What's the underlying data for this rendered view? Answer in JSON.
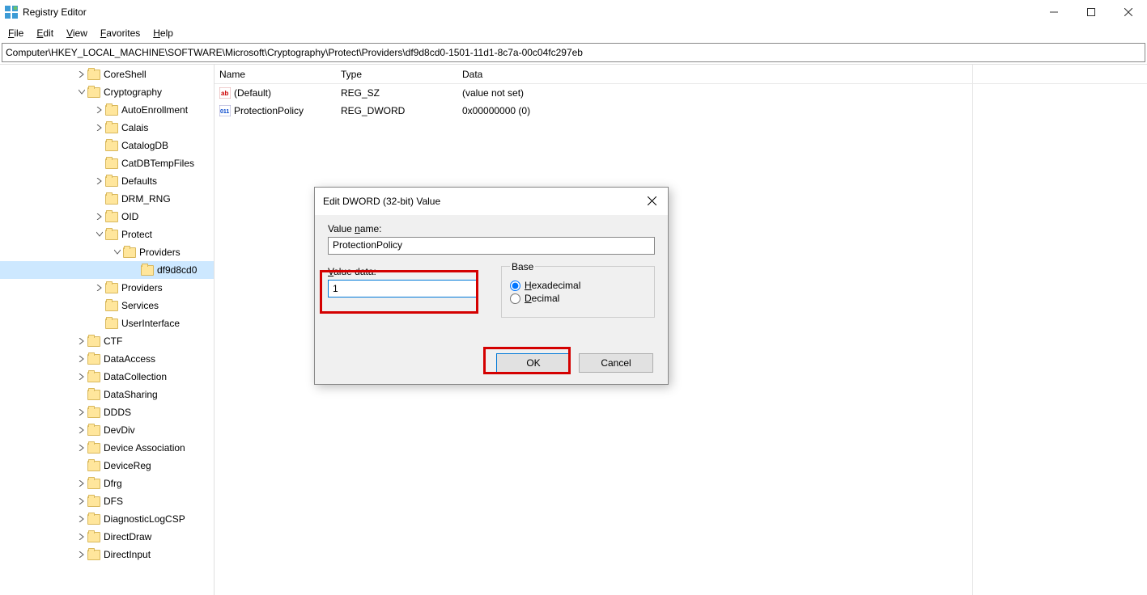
{
  "titlebar": {
    "title": "Registry Editor"
  },
  "menu": {
    "file": "File",
    "edit": "Edit",
    "view": "View",
    "favorites": "Favorites",
    "help": "Help"
  },
  "path": "Computer\\HKEY_LOCAL_MACHINE\\SOFTWARE\\Microsoft\\Cryptography\\Protect\\Providers\\df9d8cd0-1501-11d1-8c7a-00c04fc297eb",
  "tree": [
    {
      "indent": 94,
      "chev": ">",
      "label": "CoreShell"
    },
    {
      "indent": 94,
      "chev": "v",
      "label": "Cryptography"
    },
    {
      "indent": 116,
      "chev": ">",
      "label": "AutoEnrollment"
    },
    {
      "indent": 116,
      "chev": ">",
      "label": "Calais"
    },
    {
      "indent": 116,
      "chev": "",
      "label": "CatalogDB"
    },
    {
      "indent": 116,
      "chev": "",
      "label": "CatDBTempFiles"
    },
    {
      "indent": 116,
      "chev": ">",
      "label": "Defaults"
    },
    {
      "indent": 116,
      "chev": "",
      "label": "DRM_RNG"
    },
    {
      "indent": 116,
      "chev": ">",
      "label": "OID"
    },
    {
      "indent": 116,
      "chev": "v",
      "label": "Protect"
    },
    {
      "indent": 138,
      "chev": "v",
      "label": "Providers"
    },
    {
      "indent": 160,
      "chev": "",
      "label": "df9d8cd0",
      "selected": true
    },
    {
      "indent": 116,
      "chev": ">",
      "label": "Providers"
    },
    {
      "indent": 116,
      "chev": "",
      "label": "Services"
    },
    {
      "indent": 116,
      "chev": "",
      "label": "UserInterface"
    },
    {
      "indent": 94,
      "chev": ">",
      "label": "CTF"
    },
    {
      "indent": 94,
      "chev": ">",
      "label": "DataAccess"
    },
    {
      "indent": 94,
      "chev": ">",
      "label": "DataCollection"
    },
    {
      "indent": 94,
      "chev": "",
      "label": "DataSharing"
    },
    {
      "indent": 94,
      "chev": ">",
      "label": "DDDS"
    },
    {
      "indent": 94,
      "chev": ">",
      "label": "DevDiv"
    },
    {
      "indent": 94,
      "chev": ">",
      "label": "Device Association"
    },
    {
      "indent": 94,
      "chev": "",
      "label": "DeviceReg"
    },
    {
      "indent": 94,
      "chev": ">",
      "label": "Dfrg"
    },
    {
      "indent": 94,
      "chev": ">",
      "label": "DFS"
    },
    {
      "indent": 94,
      "chev": ">",
      "label": "DiagnosticLogCSP"
    },
    {
      "indent": 94,
      "chev": ">",
      "label": "DirectDraw"
    },
    {
      "indent": 94,
      "chev": ">",
      "label": "DirectInput"
    }
  ],
  "list": {
    "headers": {
      "name": "Name",
      "type": "Type",
      "data": "Data"
    },
    "rows": [
      {
        "icon": "string",
        "name": "(Default)",
        "type": "REG_SZ",
        "data": "(value not set)"
      },
      {
        "icon": "binary",
        "name": "ProtectionPolicy",
        "type": "REG_DWORD",
        "data": "0x00000000 (0)"
      }
    ]
  },
  "dialog": {
    "title": "Edit DWORD (32-bit) Value",
    "value_name_label": "Value name:",
    "value_name": "ProtectionPolicy",
    "value_data_label": "Value data:",
    "value_data": "1",
    "base_label": "Base",
    "hex_label": "Hexadecimal",
    "dec_label": "Decimal",
    "ok": "OK",
    "cancel": "Cancel"
  }
}
